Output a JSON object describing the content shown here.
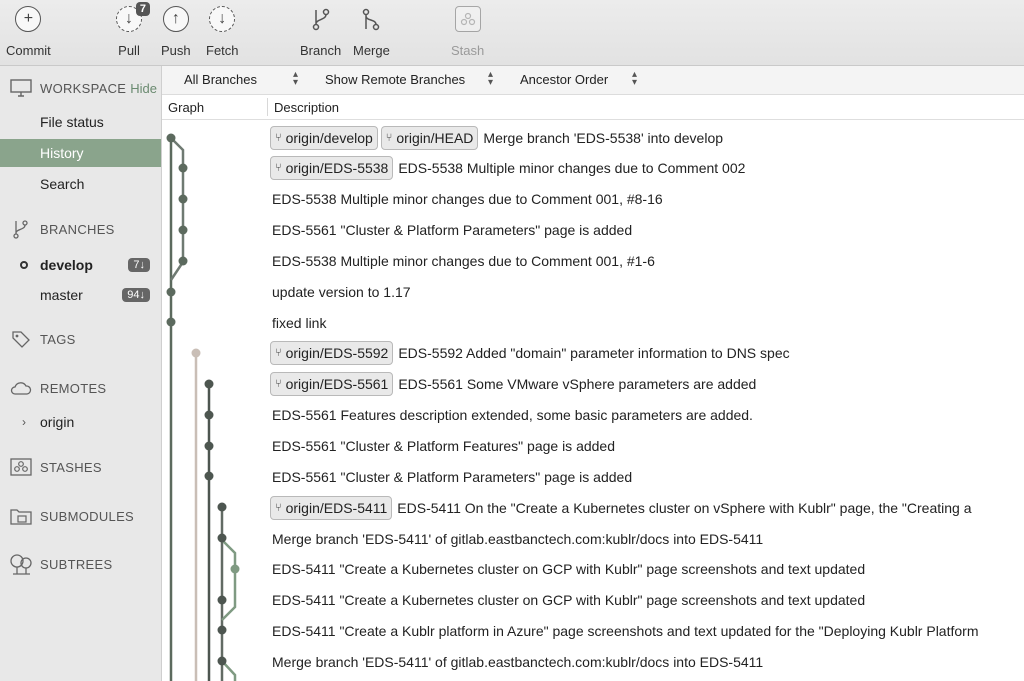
{
  "toolbar": {
    "commit": "Commit",
    "pull": "Pull",
    "pull_badge": "7",
    "push": "Push",
    "fetch": "Fetch",
    "branch": "Branch",
    "merge": "Merge",
    "stash": "Stash"
  },
  "sidebar": {
    "workspace": "WORKSPACE",
    "hide": "Hide",
    "file_status": "File status",
    "history": "History",
    "search": "Search",
    "branches": "BRANCHES",
    "develop": "develop",
    "develop_count": "7↓",
    "master": "master",
    "master_count": "94↓",
    "tags": "TAGS",
    "remotes": "REMOTES",
    "origin": "origin",
    "stashes": "STASHES",
    "submodules": "SUBMODULES",
    "subtrees": "SUBTREES"
  },
  "filters": {
    "branches": "All Branches",
    "remote": "Show Remote Branches",
    "order": "Ancestor Order"
  },
  "columns": {
    "graph": "Graph",
    "description": "Description"
  },
  "commits": [
    {
      "tags": [
        "origin/develop",
        "origin/HEAD"
      ],
      "message": "Merge branch 'EDS-5538' into develop"
    },
    {
      "tags": [
        "origin/EDS-5538"
      ],
      "message": "EDS-5538 Multiple minor changes due to Comment 002"
    },
    {
      "tags": [],
      "message": "EDS-5538 Multiple minor changes due to Comment 001, #8-16"
    },
    {
      "tags": [],
      "message": "EDS-5561 \"Cluster & Platform Parameters\" page is added"
    },
    {
      "tags": [],
      "message": "EDS-5538 Multiple minor changes due to Comment 001, #1-6"
    },
    {
      "tags": [],
      "message": "update version to 1.17"
    },
    {
      "tags": [],
      "message": "fixed link"
    },
    {
      "tags": [
        "origin/EDS-5592"
      ],
      "message": "EDS-5592 Added \"domain\" parameter information to DNS spec"
    },
    {
      "tags": [
        "origin/EDS-5561"
      ],
      "message": "EDS-5561 Some VMware vSphere parameters are added"
    },
    {
      "tags": [],
      "message": "EDS-5561 Features description extended, some basic parameters are added."
    },
    {
      "tags": [],
      "message": "EDS-5561 \"Cluster & Platform Features\" page is added"
    },
    {
      "tags": [],
      "message": "EDS-5561 \"Cluster & Platform Parameters\" page is added"
    },
    {
      "tags": [
        "origin/EDS-5411"
      ],
      "message": "EDS-5411 On the \"Create a Kubernetes cluster on vSphere with Kublr\" page, the \"Creating a"
    },
    {
      "tags": [],
      "message": "Merge branch 'EDS-5411' of gitlab.eastbanctech.com:kublr/docs into EDS-5411"
    },
    {
      "tags": [],
      "message": "EDS-5411 \"Create a Kubernetes cluster on GCP with Kublr\" page screenshots and text updated"
    },
    {
      "tags": [],
      "message": "EDS-5411 \"Create a Kubernetes cluster on GCP with Kublr\" page screenshots and text updated"
    },
    {
      "tags": [],
      "message": "EDS-5411 \"Create a Kublr platform in Azure\" page screenshots and text updated for the \"Deploying Kublr Platform"
    },
    {
      "tags": [],
      "message": "Merge branch 'EDS-5411' of gitlab.eastbanctech.com:kublr/docs into EDS-5411"
    }
  ]
}
